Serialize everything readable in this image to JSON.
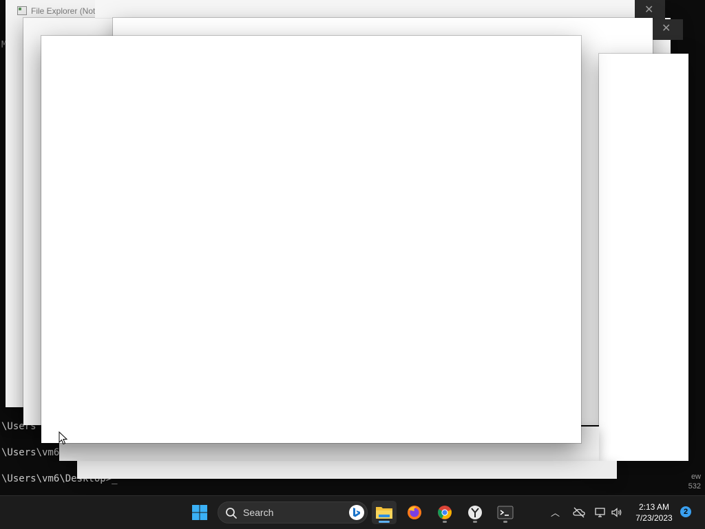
{
  "terminal": {
    "lines": [
      "\\Users",
      "\\Users\\vm6",
      "\\Users\\vm6\\Desktop>_"
    ],
    "marker": "M",
    "right_text": [
      "ew",
      "532"
    ]
  },
  "windows": {
    "file_explorer_title": "File Explorer (Not R"
  },
  "taskbar": {
    "search_label": "Search",
    "clock_time": "2:13 AM",
    "clock_date": "7/23/2023",
    "notification_count": "2",
    "apps": [
      "start-icon",
      "file-explorer-icon",
      "firefox-icon",
      "chrome-icon",
      "yandex-icon",
      "terminal-icon"
    ]
  },
  "colors": {
    "taskbar_bg": "#1c1c1c",
    "accent": "#5fb2f2",
    "notification": "#3aa0f0"
  }
}
